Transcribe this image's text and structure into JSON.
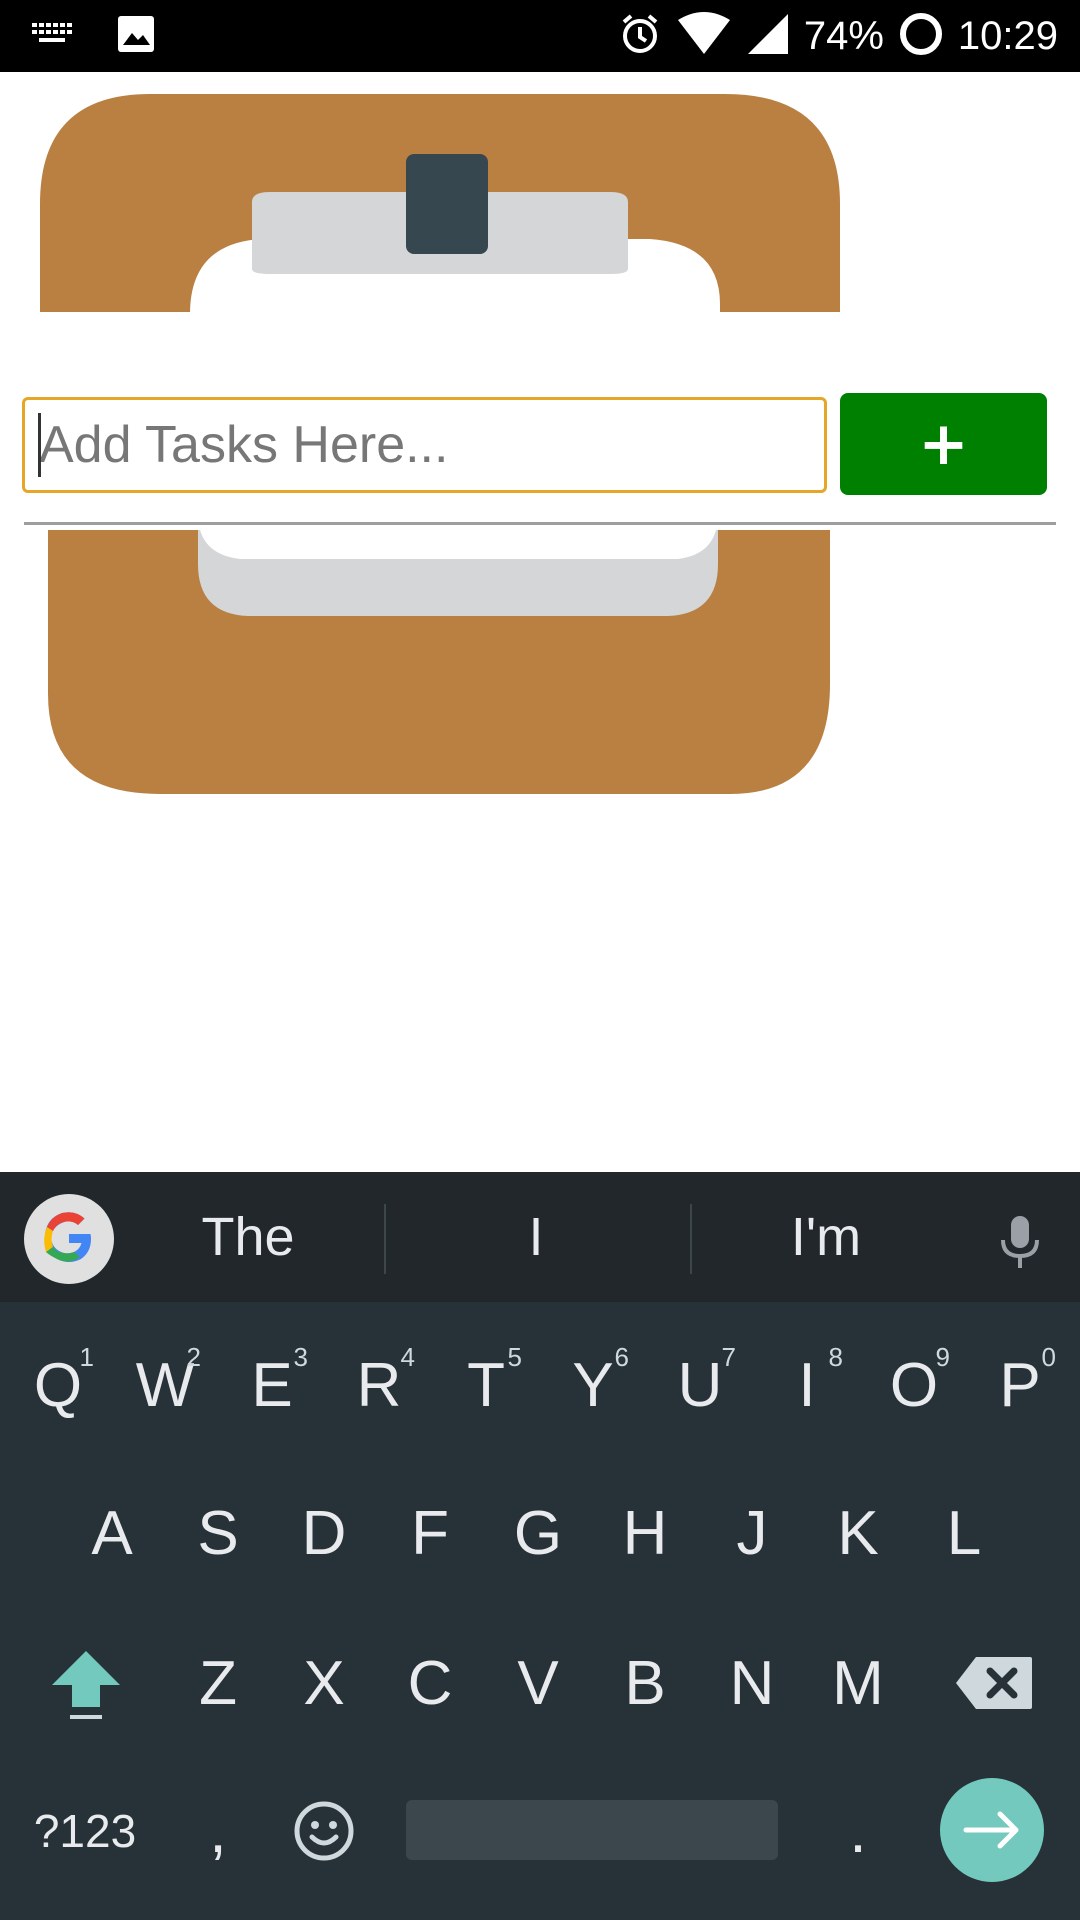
{
  "status_bar": {
    "battery_percent": "74%",
    "time": "10:29",
    "icons": [
      "keyboard-icon",
      "image-icon",
      "alarm-icon",
      "wifi-icon",
      "signal-icon",
      "battery-ring-icon"
    ]
  },
  "task_entry": {
    "placeholder": "Add Tasks Here...",
    "value": "",
    "add_button_label": "+"
  },
  "colors": {
    "add_button": "#008000",
    "input_border": "#e6a628",
    "hero_frame": "#b98042",
    "keyboard_bg": "#263238",
    "enter_key": "#73c9bd"
  },
  "keyboard": {
    "suggestions": [
      "The",
      "I",
      "I'm"
    ],
    "row1": [
      {
        "key": "Q",
        "hint": "1"
      },
      {
        "key": "W",
        "hint": "2"
      },
      {
        "key": "E",
        "hint": "3"
      },
      {
        "key": "R",
        "hint": "4"
      },
      {
        "key": "T",
        "hint": "5"
      },
      {
        "key": "Y",
        "hint": "6"
      },
      {
        "key": "U",
        "hint": "7"
      },
      {
        "key": "I",
        "hint": "8"
      },
      {
        "key": "O",
        "hint": "9"
      },
      {
        "key": "P",
        "hint": "0"
      }
    ],
    "row2": [
      "A",
      "S",
      "D",
      "F",
      "G",
      "H",
      "J",
      "K",
      "L"
    ],
    "row3": [
      "Z",
      "X",
      "C",
      "V",
      "B",
      "N",
      "M"
    ],
    "symbols_key": "?123",
    "comma_key": ",",
    "period_key": "."
  }
}
